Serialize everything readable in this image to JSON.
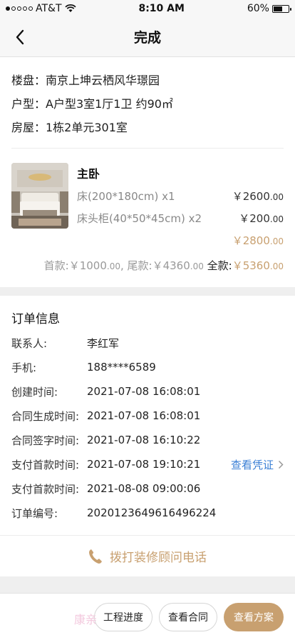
{
  "status_bar": {
    "carrier": "AT&T",
    "time": "8:10 AM",
    "battery": "60%",
    "battery_level": 0.6
  },
  "nav": {
    "title": "完成"
  },
  "property": {
    "estate": "楼盘：南京上坤云栖风华璟园",
    "layout": "户型：A户型3室1厅1卫 约90㎡",
    "unit": "房屋：1栋2单元301室"
  },
  "product": {
    "room": "主卧",
    "items": [
      {
        "name": "床(200*180cm) x1",
        "price_int": "￥2600",
        "price_dec": ".00"
      },
      {
        "name": "床头柜(40*50*45cm) x2",
        "price_int": "￥200",
        "price_dec": ".00"
      }
    ],
    "subtotal_int": "￥2800",
    "subtotal_dec": ".00"
  },
  "payment": {
    "down_label": "首款:",
    "down_int": "￥1000",
    "down_dec": ".00",
    "sep": ", ",
    "final_label": "尾款:",
    "final_int": "￥4360",
    "final_dec": ".00",
    "total_label": "全款:",
    "total_int": "￥5360",
    "total_dec": ".00"
  },
  "order": {
    "title": "订单信息",
    "rows": [
      {
        "key": "联系人:",
        "value": "李红军"
      },
      {
        "key": "手机:",
        "value": "188****6589"
      },
      {
        "key": "创建时间:",
        "value": "2021-07-08 16:08:01"
      },
      {
        "key": "合同生成时间:",
        "value": "2021-07-08 16:08:01"
      },
      {
        "key": "合同签字时间:",
        "value": "2021-07-08 16:10:22"
      },
      {
        "key": "支付首款时间:",
        "value": "2021-07-08 19:10:21",
        "action": "查看凭证"
      },
      {
        "key": "支付首款时间:",
        "value": "2021-08-08 09:00:06"
      },
      {
        "key": "订单编号:",
        "value": "2020123649616496224"
      }
    ]
  },
  "call": {
    "label": "拨打装修顾问电话"
  },
  "actions": {
    "progress": "工程进度",
    "contract": "查看合同",
    "plan": "查看方案"
  },
  "watermark": "康亲",
  "colors": {
    "accent": "#c8a070",
    "link": "#3a7fd5"
  }
}
